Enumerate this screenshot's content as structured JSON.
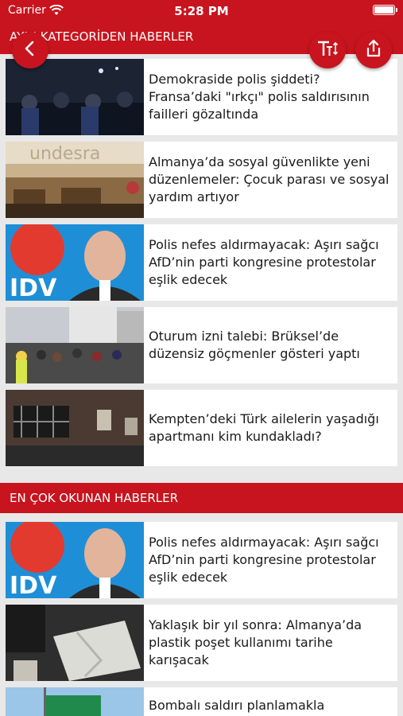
{
  "status_bar": {
    "carrier": "Carrier",
    "time": "5:28 PM"
  },
  "sections": {
    "category": {
      "title": "AYNI KATEGORİDEN HABERLER"
    },
    "most_read": {
      "title": "EN ÇOK OKUNAN HABERLER"
    }
  },
  "category_articles": [
    {
      "title": "Demokraside polis şiddeti? Fransa’daki \"ırkçı\" polis saldırısının failleri gözaltında"
    },
    {
      "title": "Almanya’da sosyal güvenlikte yeni düzenlemeler: Çocuk parası ve sosyal yardım artıyor"
    },
    {
      "title": "Polis nefes aldırmayacak: Aşırı sağcı AfD’nin parti kongresine protestolar eşlik edecek"
    },
    {
      "title": "Oturum izni talebi: Brüksel’de düzensiz göçmenler gösteri yaptı"
    },
    {
      "title": "Kempten’deki Türk ailelerin yaşadığı apartmanı kim kundakladı?"
    }
  ],
  "most_read_articles": [
    {
      "title": "Polis nefes aldırmayacak: Aşırı sağcı AfD’nin parti kongresine protestolar eşlik edecek"
    },
    {
      "title": "Yaklaşık bir yıl sonra: Almanya’da plastik poşet kullanımı tarihe karışacak"
    },
    {
      "title": "Bombalı saldırı planlamakla"
    }
  ],
  "buttons": {
    "back": "back-arrow",
    "text_size": "text-size",
    "share": "share"
  },
  "colors": {
    "brand_red": "#c8141e",
    "background": "#e8e8e8",
    "card": "#ffffff"
  }
}
